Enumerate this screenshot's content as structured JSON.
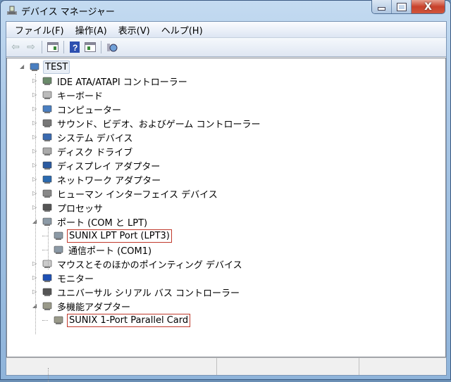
{
  "window": {
    "title": "デバイス マネージャー",
    "minimize": "—",
    "maximize": "□",
    "close": "X"
  },
  "menu": [
    "ファイル(F)",
    "操作(A)",
    "表示(V)",
    "ヘルプ(H)"
  ],
  "toolbar": [
    "back-icon",
    "forward-icon",
    "show-hide-tree-icon",
    "help-icon",
    "properties-icon",
    "scan-hardware-icon"
  ],
  "tree": [
    {
      "label": "TEST",
      "level": 0,
      "expanded": true,
      "icon": "computer-icon"
    },
    {
      "label": "IDE ATA/ATAPI コントローラー",
      "level": 1,
      "icon": "ide-controller-icon"
    },
    {
      "label": "キーボード",
      "level": 1,
      "icon": "keyboard-icon"
    },
    {
      "label": "コンピューター",
      "level": 1,
      "icon": "computer-icon"
    },
    {
      "label": "サウンド、ビデオ、およびゲーム コントローラー",
      "level": 1,
      "icon": "speaker-icon"
    },
    {
      "label": "システム デバイス",
      "level": 1,
      "icon": "system-device-icon"
    },
    {
      "label": "ディスク ドライブ",
      "level": 1,
      "icon": "disk-drive-icon"
    },
    {
      "label": "ディスプレイ アダプター",
      "level": 1,
      "icon": "display-adapter-icon"
    },
    {
      "label": "ネットワーク アダプター",
      "level": 1,
      "icon": "network-adapter-icon"
    },
    {
      "label": "ヒューマン インターフェイス デバイス",
      "level": 1,
      "icon": "hid-icon"
    },
    {
      "label": "プロセッサ",
      "level": 1,
      "icon": "processor-icon"
    },
    {
      "label": "ポート (COM と LPT)",
      "level": 1,
      "expanded": true,
      "icon": "port-icon"
    },
    {
      "label": "SUNIX LPT Port (LPT3)",
      "level": 2,
      "highlighted": true,
      "icon": "port-icon"
    },
    {
      "label": "通信ポート (COM1)",
      "level": 2,
      "icon": "port-icon"
    },
    {
      "label": "マウスとそのほかのポインティング デバイス",
      "level": 1,
      "icon": "mouse-icon"
    },
    {
      "label": "モニター",
      "level": 1,
      "icon": "monitor-icon"
    },
    {
      "label": "ユニバーサル シリアル バス コントローラー",
      "level": 1,
      "icon": "usb-icon"
    },
    {
      "label": "多機能アダプター",
      "level": 1,
      "expanded": true,
      "icon": "multifunction-adapter-icon"
    },
    {
      "label": "SUNIX 1-Port Parallel Card",
      "level": 2,
      "highlighted": true,
      "icon": "multifunction-adapter-icon"
    }
  ]
}
